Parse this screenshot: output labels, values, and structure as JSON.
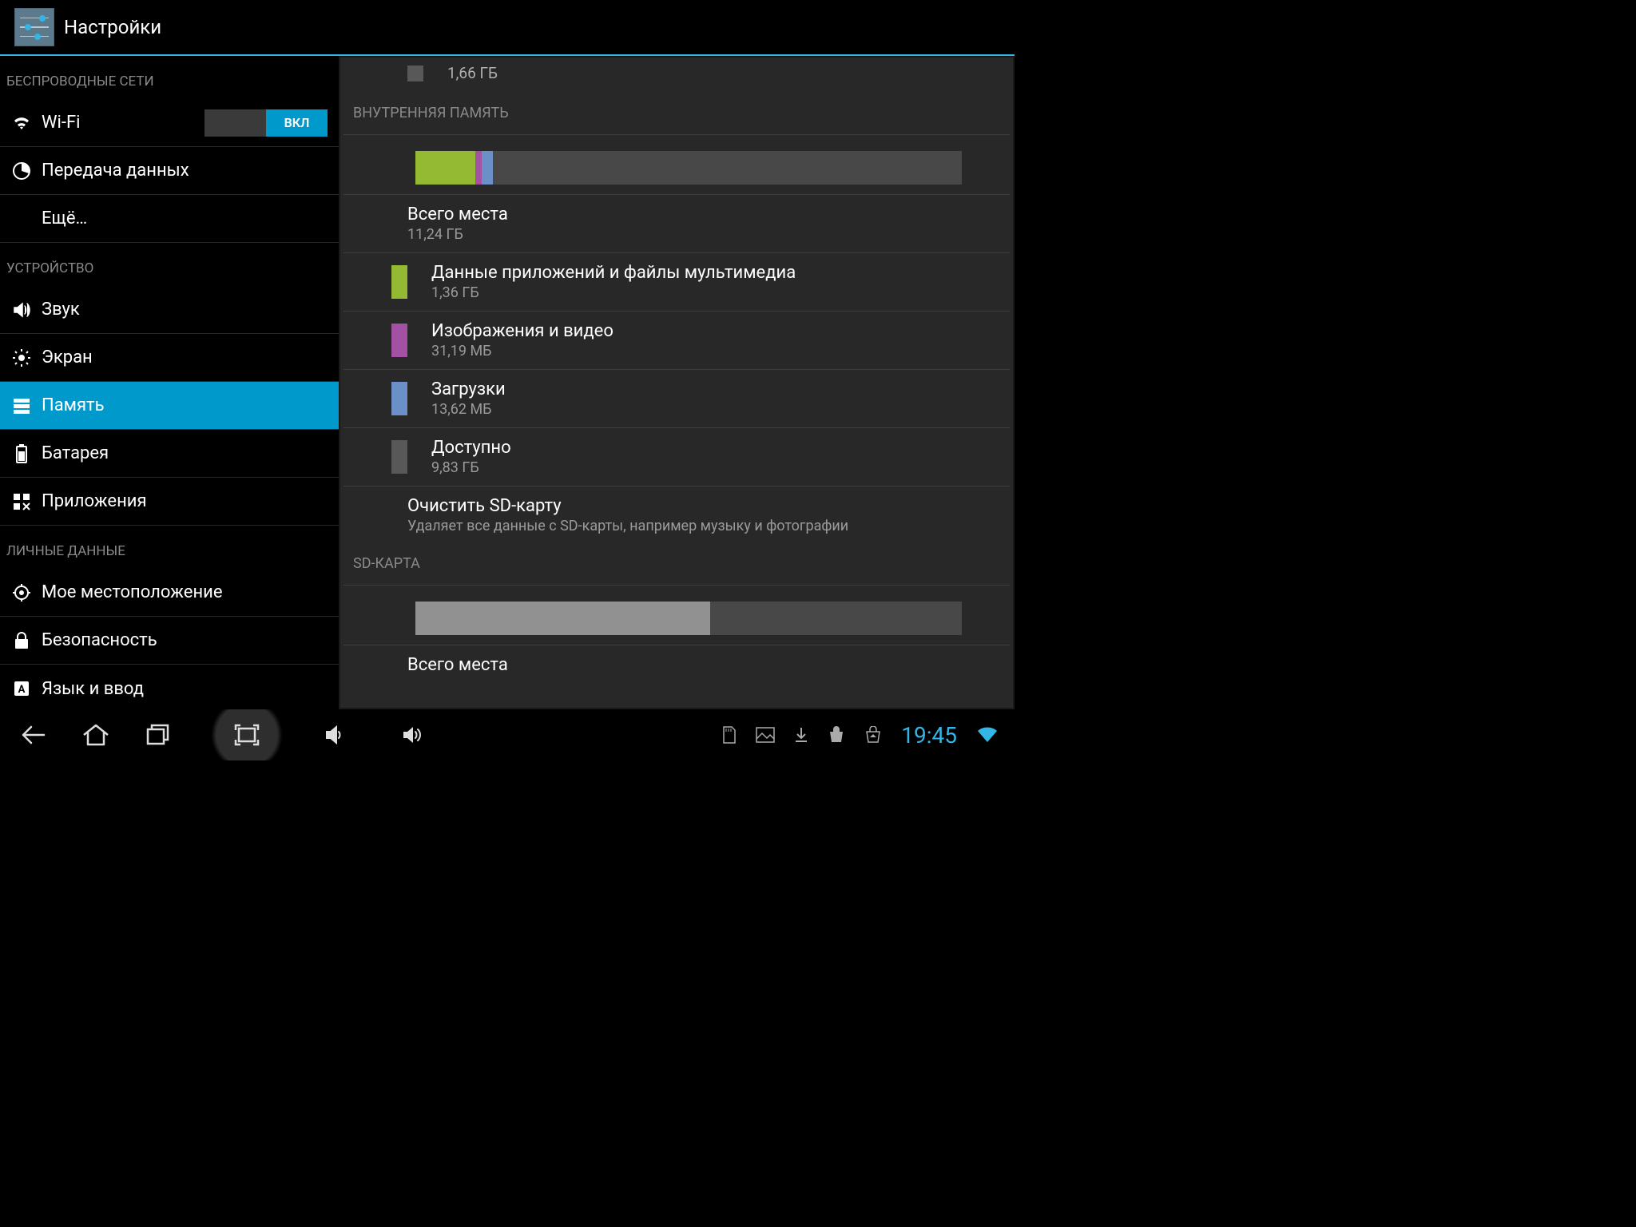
{
  "app_title": "Настройки",
  "wifi_toggle": "ВКЛ",
  "sidebar": {
    "sections": [
      {
        "header": "БЕСПРОВОДНЫЕ СЕТИ",
        "items": [
          {
            "label": "Wi-Fi",
            "icon": "wifi",
            "toggle": true
          },
          {
            "label": "Передача данных",
            "icon": "data"
          },
          {
            "label": "Ещё…",
            "icon": "none"
          }
        ]
      },
      {
        "header": "УСТРОЙСТВО",
        "items": [
          {
            "label": "Звук",
            "icon": "sound"
          },
          {
            "label": "Экран",
            "icon": "display"
          },
          {
            "label": "Память",
            "icon": "storage",
            "selected": true
          },
          {
            "label": "Батарея",
            "icon": "battery"
          },
          {
            "label": "Приложения",
            "icon": "apps"
          }
        ]
      },
      {
        "header": "ЛИЧНЫЕ ДАННЫЕ",
        "items": [
          {
            "label": "Мое местоположение",
            "icon": "location"
          },
          {
            "label": "Безопасность",
            "icon": "lock"
          },
          {
            "label": "Язык и ввод",
            "icon": "lang"
          }
        ]
      }
    ]
  },
  "content": {
    "top_remnant": "1,66 ГБ",
    "internal_header": "ВНУТРЕННЯЯ ПАМЯТЬ",
    "total": {
      "title": "Всего места",
      "sub": "11,24 ГБ"
    },
    "apps": {
      "title": "Данные приложений и файлы мультимедиа",
      "sub": "1,36 ГБ"
    },
    "pics": {
      "title": "Изображения и видео",
      "sub": "31,19 МБ"
    },
    "dl": {
      "title": "Загрузки",
      "sub": "13,62 МБ"
    },
    "avail": {
      "title": "Доступно",
      "sub": "9,83 ГБ"
    },
    "erase": {
      "title": "Очистить SD-карту",
      "sub": "Удаляет все данные с SD-карты, например музыку и фотографии"
    },
    "sd_header": "SD-КАРТА",
    "sd_total": {
      "title": "Всего места"
    }
  },
  "clock": "19:45"
}
